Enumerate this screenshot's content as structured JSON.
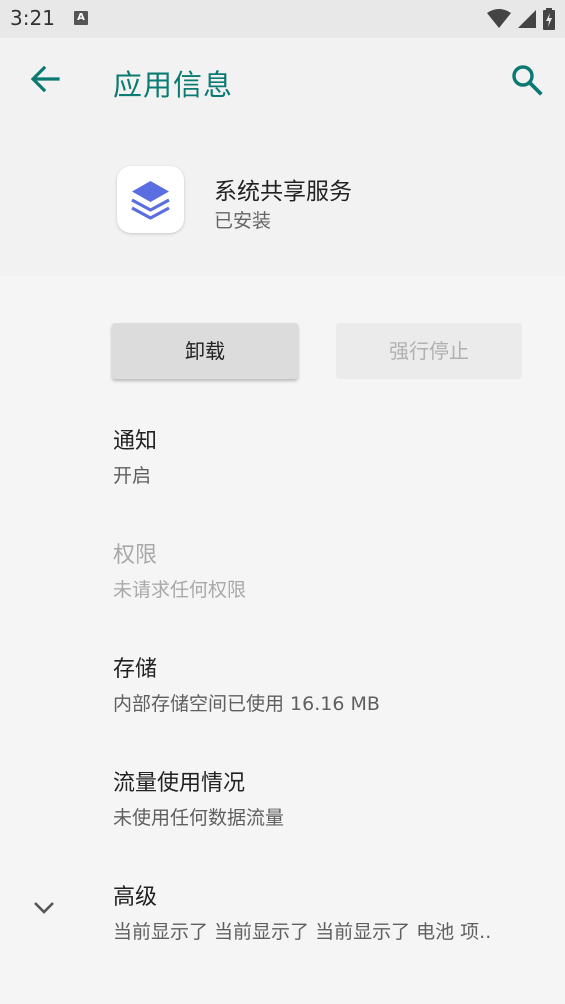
{
  "status_bar": {
    "time": "3:21",
    "notif_letter": "A"
  },
  "app_bar": {
    "title": "应用信息"
  },
  "app": {
    "name": "系统共享服务",
    "status": "已安装"
  },
  "buttons": {
    "uninstall": "卸载",
    "force_stop": "强行停止"
  },
  "items": [
    {
      "title": "通知",
      "subtitle": "开启"
    },
    {
      "title": "权限",
      "subtitle": "未请求任何权限"
    },
    {
      "title": "存储",
      "subtitle": "内部存储空间已使用 16.16 MB"
    },
    {
      "title": "流量使用情况",
      "subtitle": "未使用任何数据流量"
    },
    {
      "title": "高级",
      "subtitle": "当前显示了 当前显示了 当前显示了 电池 项.."
    }
  ],
  "colors": {
    "accent": "#0b7a72",
    "app_icon": "#5b6ee1"
  },
  "icons": [
    "back-arrow",
    "search",
    "layers",
    "chevron-down",
    "wifi",
    "signal",
    "battery"
  ]
}
